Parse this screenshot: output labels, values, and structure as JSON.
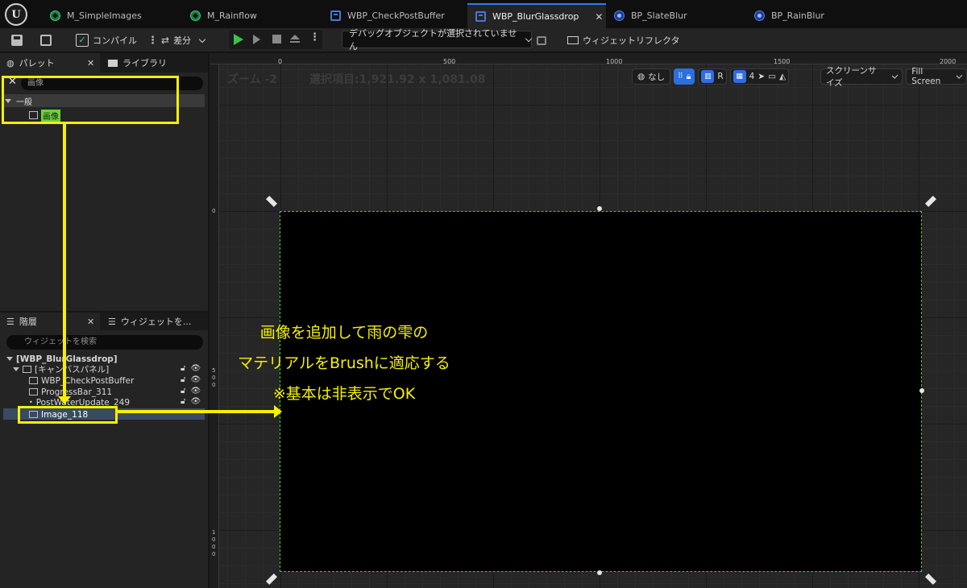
{
  "tabs": [
    {
      "label": "M_SimpleImages",
      "icon": "material-icon"
    },
    {
      "label": "M_Rainflow",
      "icon": "material-icon"
    },
    {
      "label": "WBP_CheckPostBuffer",
      "icon": "widget-blueprint-icon"
    },
    {
      "label": "WBP_BlurGlassdrop",
      "icon": "widget-blueprint-icon",
      "active": true
    },
    {
      "label": "BP_SlateBlur",
      "icon": "blueprint-icon"
    },
    {
      "label": "BP_RainBlur",
      "icon": "blueprint-icon"
    }
  ],
  "toolbar": {
    "compile_label": "コンパイル",
    "diff_label": "差分",
    "debug_object": "デバッグオブジェクトが選択されていません",
    "widget_reflector": "ウィジェットリフレクタ"
  },
  "palette": {
    "tab_palette": "パレット",
    "tab_library": "ライブラリ",
    "search_value": "画像",
    "category": "一般",
    "item_image": "画像"
  },
  "hierarchy": {
    "tab_hierarchy": "階層",
    "tab_widget": "ウィジェットを...",
    "search_placeholder": "ウィジェットを検索",
    "root": "[WBP_BlurGlassdrop]",
    "canvas": "[キャンバスパネル]",
    "items": [
      "WBP_CheckPostBuffer",
      "ProgressBar_311",
      "PostWaterUpdate_249",
      "Image_118"
    ]
  },
  "viewport": {
    "zoom": "ズーム -2",
    "selection": "選択項目:1,921.92 x 1,081.08",
    "ruler_h": [
      "0",
      "500",
      "1000",
      "1500",
      "2000"
    ],
    "ruler_v": [
      "0",
      "5",
      "0",
      "0",
      "1",
      "0",
      "0",
      "0"
    ],
    "none_label": "なし",
    "r_label": "R",
    "grid_count": "4",
    "screen_size": "スクリーンサイズ",
    "fill_mode": "Fill Screen"
  },
  "annotation": {
    "line1": "画像を追加して雨の雫の",
    "line2": "マテリアルをBrushに適応する",
    "line3": "※基本は非表示でOK",
    "color": "#f6f000"
  }
}
